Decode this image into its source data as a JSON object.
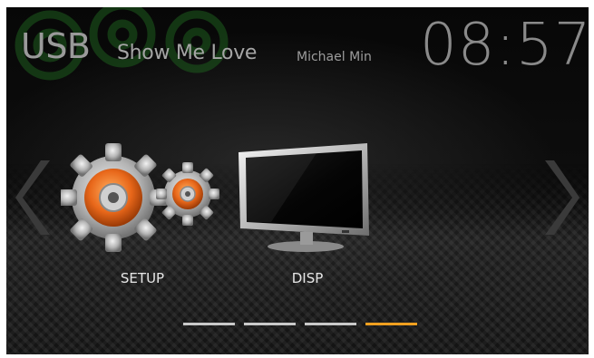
{
  "header": {
    "source": "USB",
    "track_title": "Show Me Love",
    "artist": "Michael Min",
    "clock": "08:57"
  },
  "menu": {
    "items": [
      {
        "label": "SETUP",
        "icon": "gears-icon"
      },
      {
        "label": "DISP",
        "icon": "monitor-icon"
      }
    ]
  },
  "pager": {
    "pages": 4,
    "active_page": 4
  },
  "colors": {
    "accent": "#f0a020",
    "swirl": "#1f5a1f",
    "text": "#9a9a9a"
  }
}
